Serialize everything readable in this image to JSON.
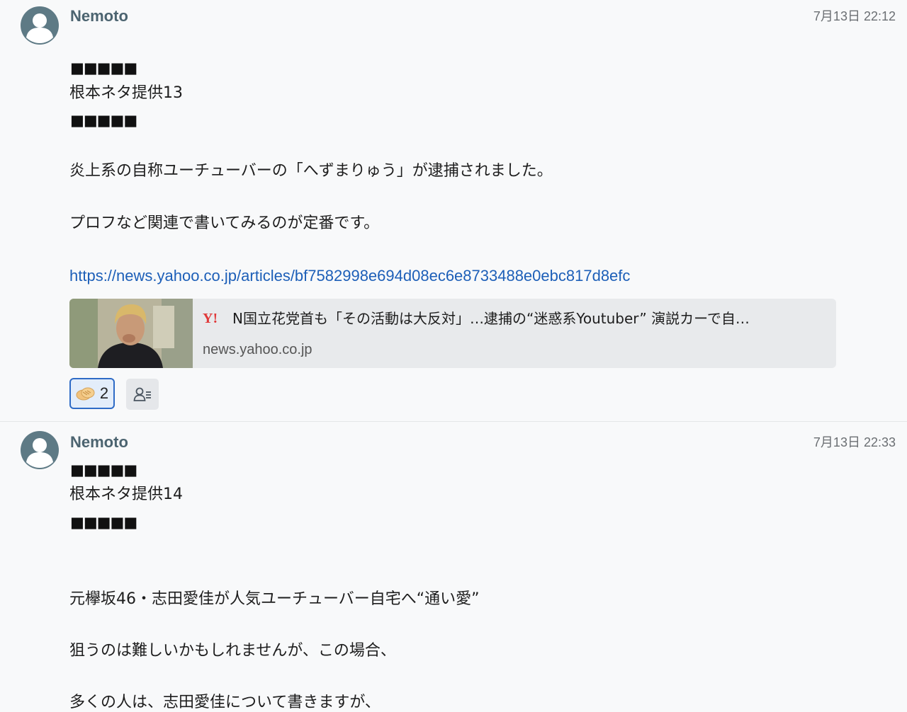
{
  "messages": [
    {
      "author": "Nemoto",
      "timestamp": "7月13日 22:12",
      "blocks_top": "■■■■■",
      "heading": "根本ネタ提供13",
      "blocks_bottom": "■■■■■",
      "paragraphs": [
        "炎上系の自称ユーチューバーの「へずまりゅう」が逮捕されました。",
        "プロフなど関連で書いてみるのが定番です。"
      ],
      "link": "https://news.yahoo.co.jp/articles/bf7582998e694d08ec6e8733488e0ebc817d8efc",
      "preview": {
        "logo": "Y!",
        "title": "N国立花党首も「その活動は大反対」…逮捕の“迷惑系Youtuber” 演説カーで自…",
        "domain": "news.yahoo.co.jp"
      },
      "reaction": {
        "icon": "handshake-icon",
        "count": "2"
      },
      "readers_icon": "readers-list-icon"
    },
    {
      "author": "Nemoto",
      "timestamp": "7月13日 22:33",
      "blocks_top": "■■■■■",
      "heading": "根本ネタ提供14",
      "blocks_bottom": "■■■■■",
      "paragraphs": [
        "元欅坂46・志田愛佳が人気ユーチューバー自宅へ“通い愛”",
        "狙うのは難しいかもしれませんが、この場合、",
        "多くの人は、志田愛佳について書きますが、"
      ]
    }
  ],
  "colors": {
    "author": "#4c6470",
    "link": "#1d5fb8",
    "reaction_border": "#2e6bc6",
    "reaction_bg": "#e3edfa"
  }
}
